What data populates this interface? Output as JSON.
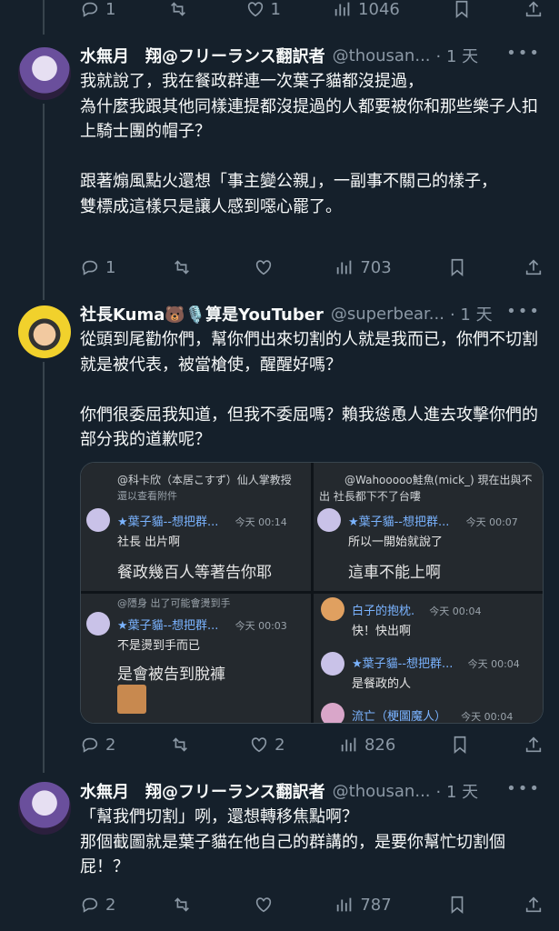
{
  "top_actions": {
    "replies": "1",
    "retweets": "",
    "likes": "1",
    "views": "1046"
  },
  "tweets": [
    {
      "name": "水無月　翔@フリーランス翻訳者",
      "handle": "@thousan...",
      "time": "· 1 天",
      "text": "我就說了，我在餐政群連一次葉子貓都沒提過，\n為什麼我跟其他同樣連提都沒提過的人都要被你和那些樂子人扣上騎士團的帽子？\n\n跟著煽風點火還想「事主變公親」，一副事不關己的樣子，\n雙標成這樣只是讓人感到噁心罷了。",
      "replies": "1",
      "retweets": "",
      "likes": "",
      "views": "703"
    },
    {
      "name": "社長Kuma🐻🎙️算是YouTuber",
      "handle": "@superbear...",
      "time": "· 1 天",
      "text": "從頭到尾勸你們，幫你們出來切割的人就是我而已，你們不切割就是被代表，被當槍使，醒醒好嗎？\n\n你們很委屈我知道，但我不委屈嗎？賴我慫恿人進去攻擊你們的部分我的道歉呢？",
      "replies": "2",
      "retweets": "",
      "likes": "2",
      "views": "826"
    },
    {
      "name": "水無月　翔@フリーランス翻訳者",
      "handle": "@thousan...",
      "time": "· 1 天",
      "text": "「幫我們切割」咧，還想轉移焦點啊？\n那個截圖就是葉子貓在他自己的群講的，是要你幫忙切割個屁！？",
      "replies": "2",
      "retweets": "",
      "likes": "",
      "views": "787"
    }
  ],
  "media": {
    "p1": {
      "reply_to": "@科卡欣（本居こすず）仙人掌教授",
      "reply_sub": "還以查看附件",
      "name": "★葉子貓--想把群...",
      "time": "今天 00:14",
      "msg1": "社長 出片啊",
      "msg2": "餐政幾百人等著告你耶"
    },
    "p2": {
      "reply_to": "@Wahooooo鮭魚(mick_) 現在出與不",
      "reply_sub": "出 社長都下不了台嘍",
      "name": "★葉子貓--想把群...",
      "time": "今天 00:07",
      "msg1": "所以一開始就說了",
      "msg2": "這車不能上啊"
    },
    "p3": {
      "reply_to": "@隱身 出了可能會燙到手",
      "name": "★葉子貓--想把群...",
      "time": "今天 00:03",
      "msg1": "不是燙到手而已",
      "msg2": "是會被告到脫褲"
    },
    "p4": {
      "name1": "白子的抱枕.",
      "time1": "今天 00:04",
      "msg1": "快！快出啊",
      "name2": "★葉子貓--想把群...",
      "time2": "今天 00:04",
      "msg2": "是餐政的人",
      "name3": "流亡（梗圖魔人）",
      "time3": "今天 00:04"
    }
  }
}
